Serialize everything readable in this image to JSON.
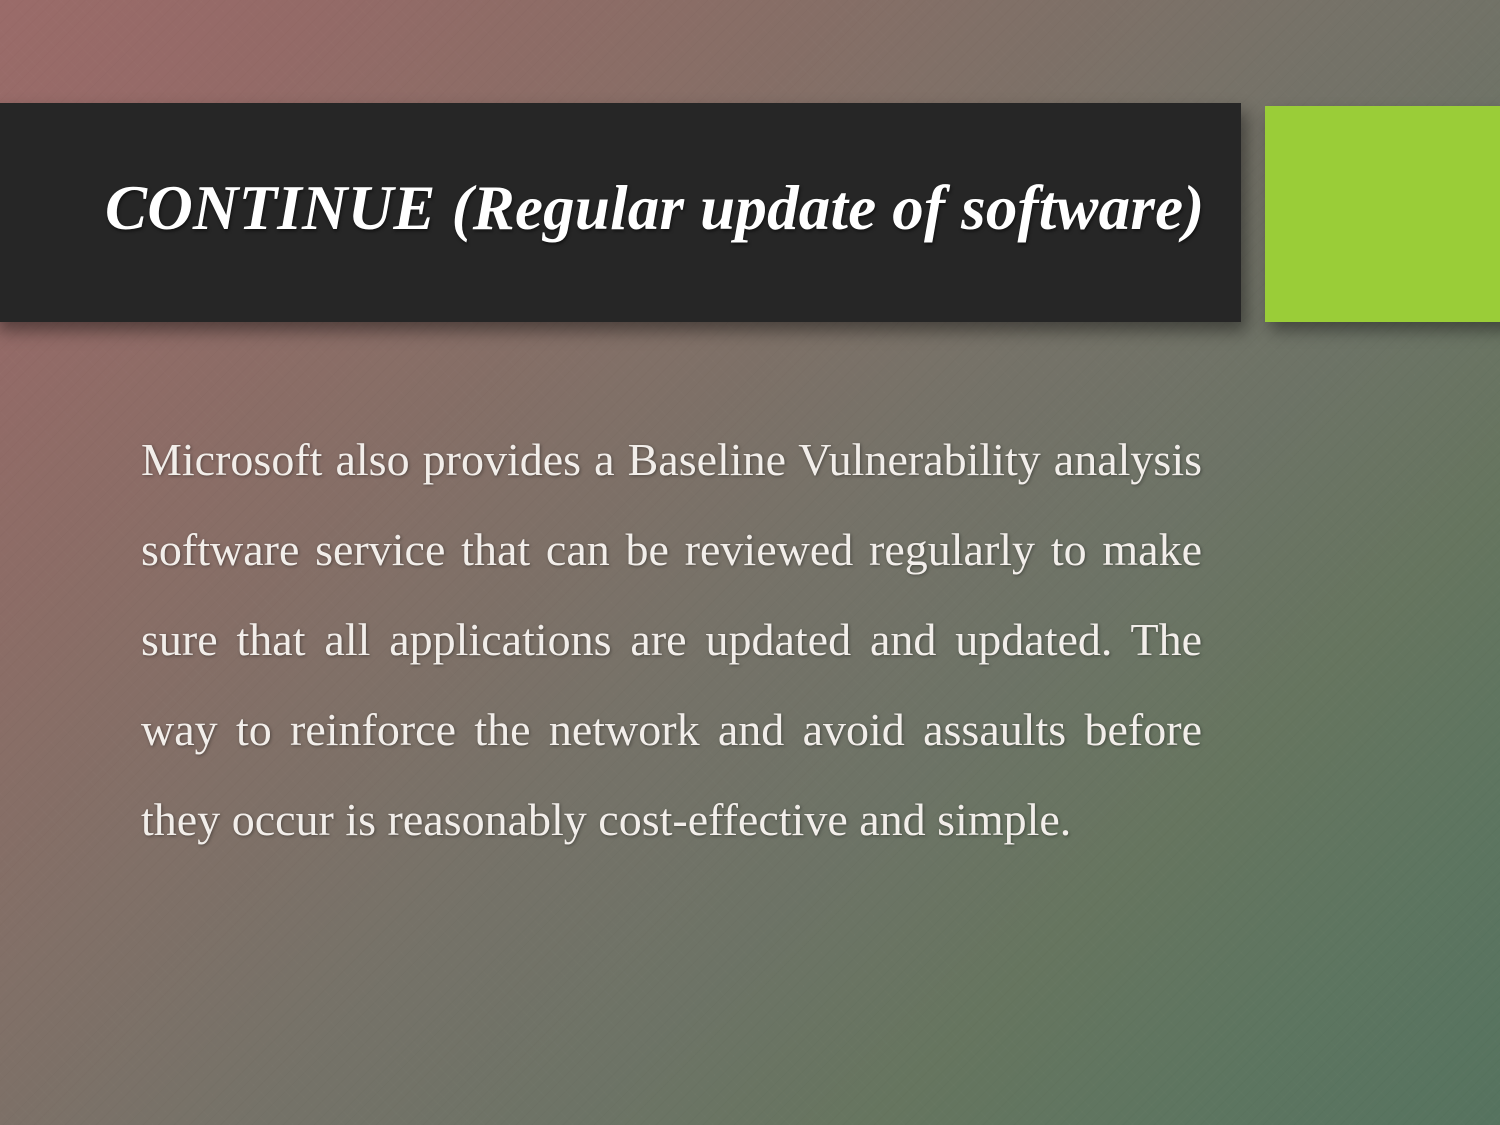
{
  "slide": {
    "title": "CONTINUE (Regular update of software)",
    "body": "Microsoft also provides a Baseline Vulnerability analysis software service that can be reviewed regularly to make sure that all applications are updated and updated. The way to reinforce the network and avoid assaults before they occur is reasonably cost-effective and simple.",
    "colors": {
      "title_bar_background": "#262626",
      "title_text": "#ffffff",
      "accent_block": "#9acd38",
      "body_text": "#f2eeea",
      "background_start": "#9a6b69",
      "background_mid": "#757268",
      "background_end": "#56735f"
    }
  }
}
